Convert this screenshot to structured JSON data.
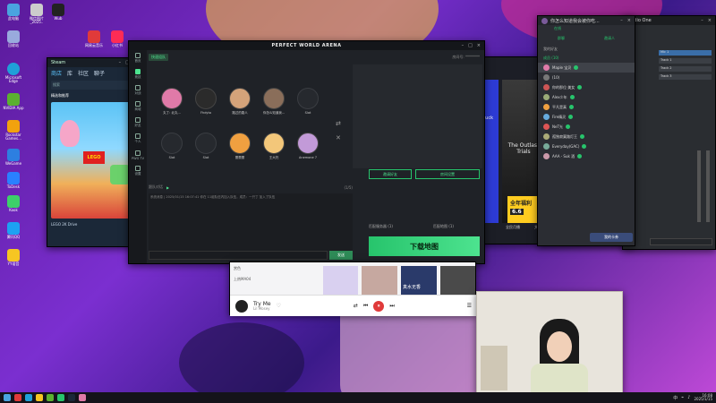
{
  "desktop": {
    "icons": [
      {
        "label": "此电脑",
        "color": "#4aa3df"
      },
      {
        "label": "回收站",
        "color": "#9ad"
      },
      {
        "label": "Microsoft Edge",
        "color": "#1fa0d8"
      },
      {
        "label": "NVIDIA App",
        "color": "#5bb130"
      },
      {
        "label": "Rockstar Games...",
        "color": "#f2a20e"
      },
      {
        "label": "WeGame",
        "color": "#2d7fe0"
      },
      {
        "label": "ToDesk",
        "color": "#2a80ff"
      },
      {
        "label": "Kook",
        "color": "#3dd06a"
      },
      {
        "label": "腾讯QQ",
        "color": "#1da1f2"
      },
      {
        "label": "YY语音",
        "color": "#f6c622"
      }
    ],
    "top_icons": [
      {
        "label": "微信图片_2025..",
        "color": "#ccc"
      },
      {
        "label": "Wub",
        "color": "#222"
      },
      {
        "label": "网易云音乐",
        "color": "#e03a3a"
      },
      {
        "label": "小红书",
        "color": "#fe2c55"
      }
    ]
  },
  "pwa": {
    "title": "PERFECT WORLD ARENA",
    "tab_active": "快速组队",
    "nav": [
      "首页",
      "竞技",
      "对战",
      "商城",
      "好友",
      "个人",
      "PWG TV",
      "设置"
    ],
    "room_label": "房间号: ********",
    "slots": [
      {
        "name": "丸丁: 北丸...",
        "color": "#e07aa8"
      },
      {
        "name": "Fhdyto",
        "color": "#2b2b2b"
      },
      {
        "name": "路过的路人",
        "color": "#d4a37a"
      },
      {
        "name": "你怎么知道我...",
        "color": "#8a6e5a"
      },
      {
        "name": "Slot",
        "color": "",
        "empty": true
      },
      {
        "name": "Slot",
        "color": "",
        "empty": true
      },
      {
        "name": "Slot",
        "color": "",
        "empty": true
      },
      {
        "name": "蕾蕾蕾",
        "color": "#f0a040"
      },
      {
        "name": "王大托",
        "color": "#f3c77a"
      },
      {
        "name": "Anemone 7",
        "color": "#c29ad8"
      }
    ],
    "invite_btn": "邀请好友",
    "settings_btn": "房间设置",
    "download_btn": "下载地图",
    "chat_line": "系统消息 | 2025/01/15 16:07:41 你在 11组队伍内加入队伍，成员：一只丁 加入了队伍",
    "send_btn": "发送",
    "chat_label": "跟队对话",
    "stats": "(1/5)",
    "server_1": "匹配服务器 (1)",
    "server_2": "匹配地图 (1)"
  },
  "steam": {
    "menu": [
      "商店",
      "库",
      "社区",
      "聊子"
    ],
    "section": "精选和推荐",
    "caption": "LEGO 2K Drive",
    "search_placeholder": "搜索"
  },
  "chat_panel": {
    "title": "你怎么知道我会被你吃...",
    "subtitle": "在线",
    "tab_1": "群聊",
    "tab_2": "邀请人",
    "group_header": "我的好友",
    "members_header": "成员 (10)",
    "members": [
      {
        "name": "Maple 宝贝",
        "color": "#e07aa8",
        "highlight": true
      },
      {
        "name": "(10)",
        "color": "#777"
      },
      {
        "name": "你的那位 美女",
        "color": "#c55"
      },
      {
        "name": "Alex少年",
        "color": "#9a7"
      },
      {
        "name": "平凡是真",
        "color": "#f0a040"
      },
      {
        "name": "Fire精灵",
        "color": "#6ad"
      },
      {
        "name": "NeT光",
        "color": "#d55"
      },
      {
        "name": "孤独寂寞路灯王",
        "color": "#aa7"
      },
      {
        "name": "Everyday(GAC)",
        "color": "#7a9"
      },
      {
        "name": "AAA - Suk 酒",
        "color": "#c9a"
      }
    ],
    "bottom_btn": "我的卡券"
  },
  "store": {
    "game_1": "Stuck",
    "game_2": "The Outlast Trials",
    "banner_1": "全年福利",
    "banner_2": "6.6",
    "label_1": "全民月播",
    "label_2": "大学生优惠"
  },
  "studio": {
    "title": "Studio One",
    "tracks": [
      "Mic 1",
      "Track 1",
      "Track 2",
      "Track 3"
    ]
  },
  "music": {
    "song": "Try Me",
    "artist": "Lil Mosey",
    "rec_1": "赏色",
    "rec_2": "上热MA04",
    "poster_1": "真水无香"
  },
  "taskbar": {
    "time": "16:08",
    "date": "2025/1/15",
    "lang": "中"
  }
}
